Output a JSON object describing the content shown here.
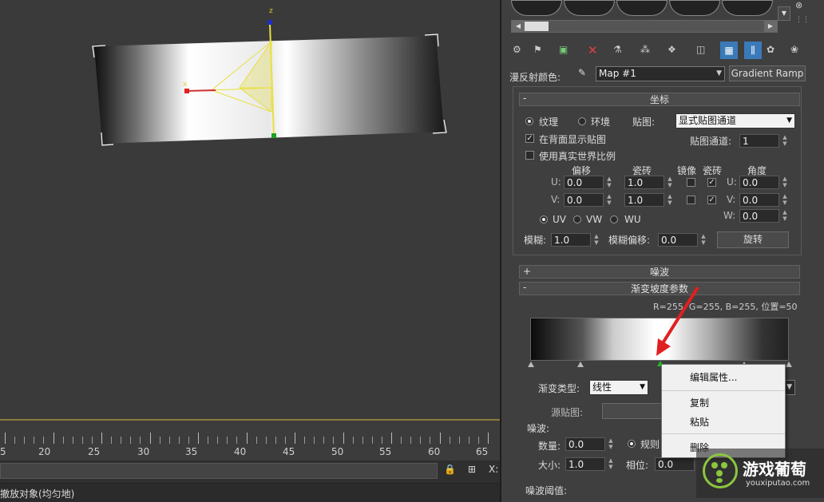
{
  "viewport": {
    "axis_x": "x",
    "axis_z": "z"
  },
  "ruler": {
    "labels": [
      "5",
      "20",
      "25",
      "30",
      "35",
      "40",
      "45",
      "50",
      "55",
      "60",
      "65"
    ]
  },
  "status": {
    "text": "撤放对象(均匀地)"
  },
  "panel": {
    "diffuse_label": "漫反射颜色:",
    "map_name": "Map #1",
    "map_type": "Gradient Ramp",
    "coords": {
      "header": "坐标",
      "texture": "纹理",
      "environ": "环境",
      "map_label": "贴图:",
      "map_channel_select": "显式贴图通道",
      "show_back": "在背面显示贴图",
      "channel_label": "贴图通道:",
      "channel_value": "1",
      "real_world": "使用真实世界比例",
      "offset": "偏移",
      "tiling": "瓷砖",
      "mirror": "镜像",
      "tile": "瓷砖",
      "angle": "角度",
      "u": "U:",
      "v": "V:",
      "w": "W:",
      "u_offset": "0.0",
      "v_offset": "0.0",
      "u_tiling": "1.0",
      "v_tiling": "1.0",
      "u_angle": "0.0",
      "v_angle": "0.0",
      "w_angle": "0.0",
      "uv": "UV",
      "vw": "VW",
      "wu": "WU",
      "blur_label": "模糊:",
      "blur": "1.0",
      "blur_off_label": "模糊偏移:",
      "blur_off": "0.0",
      "rotate": "旋转"
    },
    "noise_header": "噪波",
    "gradient": {
      "header": "渐变坡度参数",
      "info": "R=255, G=255, B=255, 位置=50",
      "type_label": "渐变类型:",
      "type_value": "线性",
      "source_label": "源贴图:"
    },
    "noise": {
      "label": "噪波:",
      "amount_label": "数量:",
      "amount": "0.0",
      "regular": "规则",
      "size_label": "大小:",
      "size": "1.0",
      "phase_label": "相位:",
      "phase": "0.0",
      "threshold_label": "噪波阈值:"
    }
  },
  "context_menu": {
    "edit": "编辑属性...",
    "copy": "复制",
    "paste": "粘贴",
    "delete": "删除"
  },
  "watermark": {
    "title": "游戏葡萄",
    "url": "youxiputao.com"
  }
}
